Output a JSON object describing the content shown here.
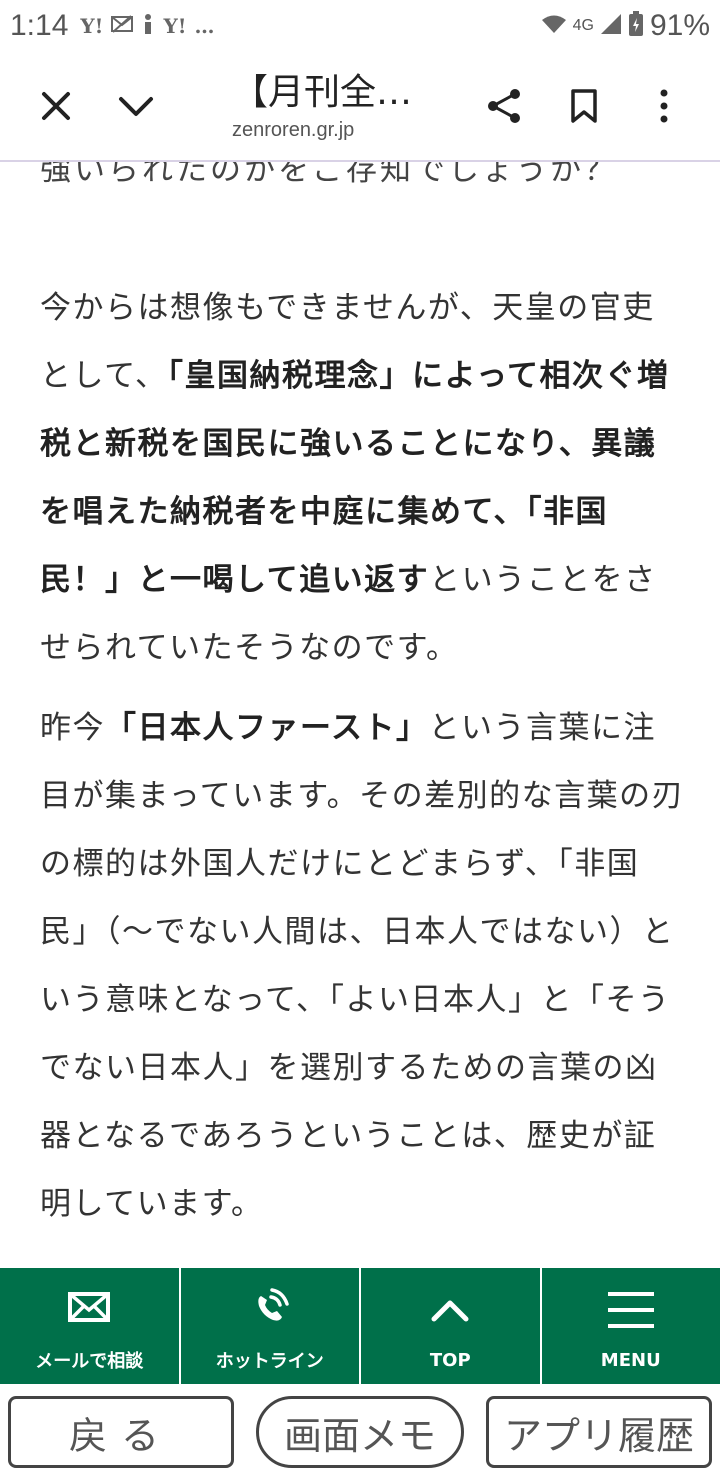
{
  "status_bar": {
    "time": "1:14",
    "left_icons": [
      "Y!",
      "mail-off",
      "info",
      "Y!",
      "…"
    ],
    "network": "4G",
    "battery": "91%"
  },
  "browser": {
    "title": "【月刊全…",
    "url": "zenroren.gr.jp"
  },
  "article": {
    "cut_line": "強いられたのかをご存知でしょうか？",
    "p1": {
      "s1": "今からは想像もできませんが、天皇の官吏として、",
      "s2": "「皇国納税理念」によって相次ぐ増税と新税を国民に強いることになり、異議を唱えた納税者を中庭に集めて、「非国民！」と一喝して追い返す",
      "s3": "ということをさせられていたそうなのです。"
    },
    "p2": {
      "s1": "昨今",
      "s2": "「日本人ファースト」",
      "s3": "という言葉に注目が集まっています。その差別的な言葉の刃の標的は外国人だけにとどまらず、「非国民」（〜でない人間は、日本人ではない）という意味となって、「よい日本人」と「そうでない日本人」を選別するための言葉の凶器となるであろうということは、歴史が証明しています。"
    }
  },
  "bottom_nav": {
    "mail": "メールで相談",
    "hotline": "ホットライン",
    "top": "TOP",
    "menu": "MENU"
  },
  "system_bar": {
    "back": "戻る",
    "memo": "画面メモ",
    "history": "アプリ履歴"
  },
  "colors": {
    "nav_green": "#00704a",
    "text": "#333333"
  }
}
